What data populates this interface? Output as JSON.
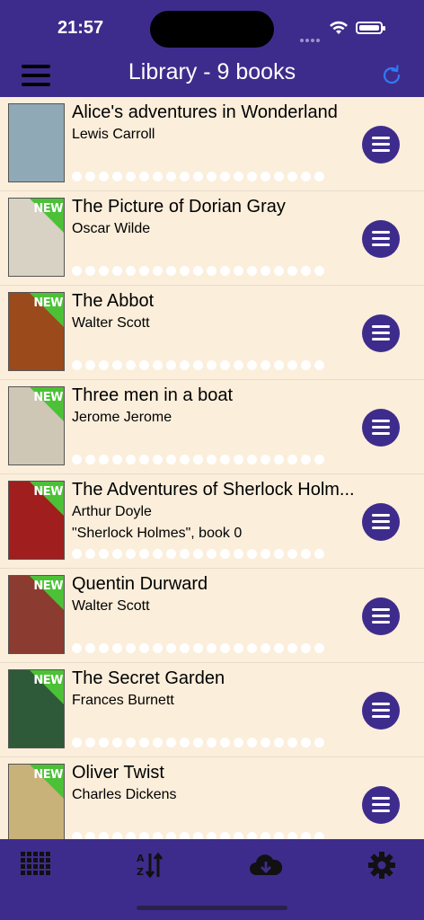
{
  "status": {
    "time": "21:57"
  },
  "header": {
    "title": "Library - 9 books"
  },
  "books": [
    {
      "title": "Alice's adventures in Wonderland",
      "author": "Lewis Carroll",
      "series": "",
      "is_new": false,
      "cover_color": "#8fa9b6"
    },
    {
      "title": "The Picture of Dorian Gray",
      "author": "Oscar Wilde",
      "series": "",
      "is_new": true,
      "cover_color": "#d8d2c4"
    },
    {
      "title": "The Abbot",
      "author": "Walter Scott",
      "series": "",
      "is_new": true,
      "cover_color": "#9b4a1c"
    },
    {
      "title": "Three men in a boat",
      "author": "Jerome Jerome",
      "series": "",
      "is_new": true,
      "cover_color": "#cfc7b5"
    },
    {
      "title": "The Adventures of Sherlock Holm...",
      "author": "Arthur Doyle",
      "series": "\"Sherlock Holmes\", book 0",
      "is_new": true,
      "cover_color": "#a01e1e"
    },
    {
      "title": "Quentin Durward",
      "author": "Walter Scott",
      "series": "",
      "is_new": true,
      "cover_color": "#8b3b30"
    },
    {
      "title": "The Secret Garden",
      "author": "Frances Burnett",
      "series": "",
      "is_new": true,
      "cover_color": "#2f5a3a"
    },
    {
      "title": "Oliver Twist",
      "author": "Charles Dickens",
      "series": "",
      "is_new": true,
      "cover_color": "#c9b27a"
    }
  ],
  "new_badge": "NEW",
  "colors": {
    "accent": "#3e2c8c",
    "background": "#fbeedb",
    "new_badge": "#4cc137",
    "refresh": "#2f7bf5"
  },
  "tabs": [
    {
      "icon": "grid-icon"
    },
    {
      "icon": "sort-az-icon"
    },
    {
      "icon": "cloud-download-icon"
    },
    {
      "icon": "gear-icon"
    }
  ]
}
